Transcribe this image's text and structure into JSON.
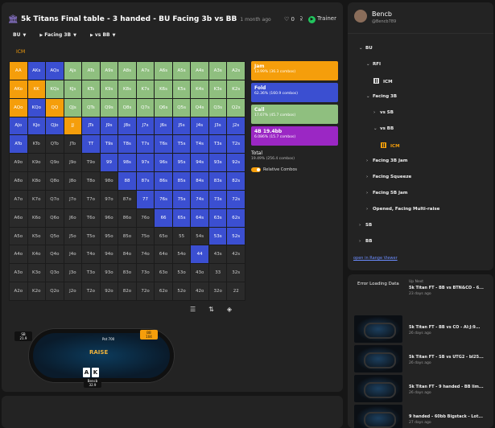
{
  "header": {
    "title": "5k Titans Final table - 3 handed - BU Facing 3b vs BB",
    "time": "1 month ago",
    "like_count": "0",
    "trainer_label": "Trainer"
  },
  "path": [
    "BU",
    "Facing 3B",
    "vs BB"
  ],
  "icm_tag": "ICM",
  "grid": [
    [
      "AA",
      "AKs",
      "AQs",
      "AJs",
      "ATs",
      "A9s",
      "A8s",
      "A7s",
      "A6s",
      "A5s",
      "A4s",
      "A3s",
      "A2s"
    ],
    [
      "AKo",
      "KK",
      "KQs",
      "KJs",
      "KTs",
      "K9s",
      "K8s",
      "K7s",
      "K6s",
      "K5s",
      "K4s",
      "K3s",
      "K2s"
    ],
    [
      "AQo",
      "KQo",
      "QQ",
      "QJs",
      "QTs",
      "Q9s",
      "Q8s",
      "Q7s",
      "Q6s",
      "Q5s",
      "Q4s",
      "Q3s",
      "Q2s"
    ],
    [
      "AJo",
      "KJo",
      "QJo",
      "JJ",
      "JTs",
      "J9s",
      "J8s",
      "J7s",
      "J6s",
      "J5s",
      "J4s",
      "J3s",
      "J2s"
    ],
    [
      "ATo",
      "KTo",
      "QTo",
      "JTo",
      "TT",
      "T9s",
      "T8s",
      "T7s",
      "T6s",
      "T5s",
      "T4s",
      "T3s",
      "T2s"
    ],
    [
      "A9o",
      "K9o",
      "Q9o",
      "J9o",
      "T9o",
      "99",
      "98s",
      "97s",
      "96s",
      "95s",
      "94s",
      "93s",
      "92s"
    ],
    [
      "A8o",
      "K8o",
      "Q8o",
      "J8o",
      "T8o",
      "98o",
      "88",
      "87s",
      "86s",
      "85s",
      "84s",
      "83s",
      "82s"
    ],
    [
      "A7o",
      "K7o",
      "Q7o",
      "J7o",
      "T7o",
      "97o",
      "87o",
      "77",
      "76s",
      "75s",
      "74s",
      "73s",
      "72s"
    ],
    [
      "A6o",
      "K6o",
      "Q6o",
      "J6o",
      "T6o",
      "96o",
      "86o",
      "76o",
      "66",
      "65s",
      "64s",
      "63s",
      "62s"
    ],
    [
      "A5o",
      "K5o",
      "Q5o",
      "J5o",
      "T5o",
      "95o",
      "85o",
      "75o",
      "65o",
      "55",
      "54s",
      "53s",
      "52s"
    ],
    [
      "A4o",
      "K4o",
      "Q4o",
      "J4o",
      "T4o",
      "94o",
      "84o",
      "74o",
      "64o",
      "54o",
      "44",
      "43s",
      "42s"
    ],
    [
      "A3o",
      "K3o",
      "Q3o",
      "J3o",
      "T3o",
      "93o",
      "83o",
      "73o",
      "63o",
      "53o",
      "43o",
      "33",
      "32s"
    ],
    [
      "A2o",
      "K2o",
      "Q2o",
      "J2o",
      "T2o",
      "92o",
      "82o",
      "72o",
      "62o",
      "52o",
      "42o",
      "32o",
      "22"
    ]
  ],
  "colors": {
    "jam": "#f59e0b",
    "fold": "#3b4fd1",
    "call": "#8fbf7f",
    "fourbet": "#9b27c4",
    "empty": "#2a2a2a"
  },
  "cell_actions": [
    [
      "J",
      "F",
      "F",
      "C",
      "C",
      "C",
      "C",
      "C",
      "C",
      "C",
      "C",
      "C",
      "C"
    ],
    [
      "J",
      "J",
      "C",
      "C",
      "C",
      "C",
      "C",
      "C",
      "C",
      "C",
      "C",
      "C",
      "C"
    ],
    [
      "J",
      "F",
      "J",
      "C",
      "C",
      "C",
      "C",
      "C",
      "C",
      "C",
      "C",
      "C",
      "C"
    ],
    [
      "F",
      "F",
      "F",
      "J",
      "F",
      "F",
      "F",
      "F",
      "F",
      "F",
      "F",
      "F",
      "F"
    ],
    [
      "F",
      "E",
      "E",
      "E",
      "F",
      "F",
      "F",
      "F",
      "F",
      "F",
      "F",
      "F",
      "F"
    ],
    [
      "E",
      "E",
      "E",
      "E",
      "E",
      "F",
      "F",
      "F",
      "F",
      "F",
      "F",
      "F",
      "F"
    ],
    [
      "E",
      "E",
      "E",
      "E",
      "E",
      "E",
      "F",
      "F",
      "F",
      "F",
      "F",
      "F",
      "F"
    ],
    [
      "E",
      "E",
      "E",
      "E",
      "E",
      "E",
      "E",
      "F",
      "F",
      "F",
      "F",
      "F",
      "F"
    ],
    [
      "E",
      "E",
      "E",
      "E",
      "E",
      "E",
      "E",
      "E",
      "F",
      "F",
      "F",
      "F",
      "F"
    ],
    [
      "E",
      "E",
      "E",
      "E",
      "E",
      "E",
      "E",
      "E",
      "E",
      "E",
      "E",
      "F",
      "F"
    ],
    [
      "E",
      "E",
      "E",
      "E",
      "E",
      "E",
      "E",
      "E",
      "E",
      "E",
      "F",
      "E",
      "E"
    ],
    [
      "E",
      "E",
      "E",
      "E",
      "E",
      "E",
      "E",
      "E",
      "E",
      "E",
      "E",
      "E",
      "E"
    ],
    [
      "E",
      "E",
      "E",
      "E",
      "E",
      "E",
      "E",
      "E",
      "E",
      "E",
      "E",
      "E",
      "E"
    ]
  ],
  "legend": [
    {
      "key": "jam",
      "label": "Jam",
      "sub": "13.99% (36.3 combos)"
    },
    {
      "key": "fold",
      "label": "Fold",
      "sub": "62.36% (160.9 combos)"
    },
    {
      "key": "call",
      "label": "Call",
      "sub": "17.67% (45.7 combos)"
    },
    {
      "key": "fourbet",
      "label": "4B 19.4bb",
      "sub": "6.086% (15.7 combos)"
    }
  ],
  "total": {
    "label": "Total",
    "sub": "19.49% (256.4 combos)"
  },
  "relative_combos_label": "Relative Combos",
  "poker_table": {
    "logo": "RAISE",
    "pot_label": "Pot 700",
    "seat_left": {
      "name": "SB",
      "stack": "21.9"
    },
    "seat_right": {
      "name": "BB",
      "stack": "104"
    },
    "hero": {
      "name": "Bencb",
      "stack": "32.9"
    },
    "hero_cards": [
      "A",
      "K"
    ]
  },
  "user": {
    "name": "Bencb",
    "handle": "@Bencb789"
  },
  "tree": [
    {
      "label": "BU",
      "depth": 0,
      "chev": "v"
    },
    {
      "label": "RFI",
      "depth": 1,
      "chev": "v"
    },
    {
      "label": "ICM",
      "depth": 2,
      "icon": true
    },
    {
      "label": "Facing 3B",
      "depth": 1,
      "chev": "v"
    },
    {
      "label": "vs SB",
      "depth": 2,
      "chev": ">"
    },
    {
      "label": "vs BB",
      "depth": 2,
      "chev": "v"
    },
    {
      "label": "ICM",
      "depth": 3,
      "icon": true,
      "selected": true
    },
    {
      "label": "Facing 3B Jam",
      "depth": 1,
      "chev": ">"
    },
    {
      "label": "Facing Squeeze",
      "depth": 1,
      "chev": ">"
    },
    {
      "label": "Facing 5B Jam",
      "depth": 1,
      "chev": ">"
    },
    {
      "label": "Opened, Facing Multi-raise",
      "depth": 1,
      "chev": ">"
    },
    {
      "label": "SB",
      "depth": 0,
      "chev": ">"
    },
    {
      "label": "BB",
      "depth": 0,
      "chev": ">"
    }
  ],
  "range_link": "open in Range Viewer",
  "videos_panel": {
    "error": "Error Loading Data",
    "up_next": "Up Next",
    "first": {
      "title": "5k Titan FT - BB vs BTN&CO - 6...",
      "age": "23 days ago"
    },
    "items": [
      {
        "title": "5k Titan FT - BB vs CO - Al:J:9...",
        "age": "26 days ago"
      },
      {
        "title": "5k Titan FT - SB vs UTG2 - bl25...",
        "age": "26 days ago"
      },
      {
        "title": "5k Titan FT - 9 handed - BB lim...",
        "age": "26 days ago"
      },
      {
        "title": "9 handed - 60bb Bigstack - Lot...",
        "age": "27 days ago"
      }
    ]
  }
}
